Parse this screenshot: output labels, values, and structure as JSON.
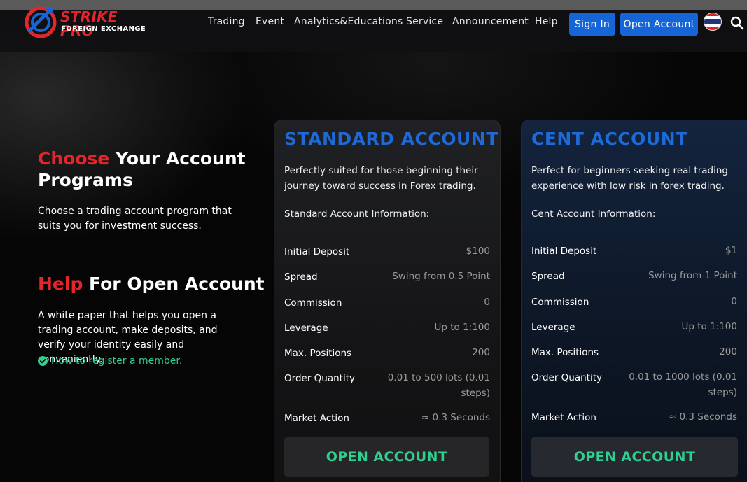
{
  "header": {
    "logo": {
      "name": "STRIKE PRO",
      "tagline": "FOREIGN EXCHANGE"
    },
    "nav": [
      "Trading",
      "Event",
      "Analytics&Educations",
      "Service",
      "Announcement",
      "Help"
    ],
    "sign_in": "Sign In",
    "open_account": "Open Account",
    "flag_icon": "thailand-flag-icon",
    "search_icon": "search-icon"
  },
  "left": {
    "choose_highlight": "Choose",
    "choose_rest": " Your Account",
    "choose_line2": "Programs",
    "choose_desc": "Choose a trading account program that suits you for investment success.",
    "help_highlight": "Help",
    "help_rest": " For Open Account",
    "help_desc": "A white paper that helps you open a trading account, make deposits, and verify your identity easily and conveniently.",
    "register_link": "How to register a member."
  },
  "cards": [
    {
      "title": "STANDARD ACCOUNT",
      "desc": "Perfectly suited for those beginning their journey toward success in Forex trading.",
      "info": "Standard Account Information:",
      "rows": [
        {
          "label": "Initial Deposit",
          "value": "$100"
        },
        {
          "label": "Spread",
          "value": "Swing from 0.5 Point"
        },
        {
          "label": "Commission",
          "value": "0"
        },
        {
          "label": "Leverage",
          "value": "Up to 1:100"
        },
        {
          "label": "Max. Positions",
          "value": "200"
        },
        {
          "label": "Order Quantity",
          "value": "0.01 to 500 lots (0.01 steps)"
        },
        {
          "label": "Market Action",
          "value": "≈ 0.3 Seconds"
        }
      ],
      "button": "OPEN ACCOUNT"
    },
    {
      "title": "CENT ACCOUNT",
      "desc": "Perfect for beginners seeking real trading experience with low risk in forex trading.",
      "info": "Cent Account Information:",
      "rows": [
        {
          "label": "Initial Deposit",
          "value": "$1"
        },
        {
          "label": "Spread",
          "value": "Swing from 1 Point"
        },
        {
          "label": "Commission",
          "value": "0"
        },
        {
          "label": "Leverage",
          "value": "Up to 1:100"
        },
        {
          "label": "Max. Positions",
          "value": "200"
        },
        {
          "label": "Order Quantity",
          "value": "0.01 to 1000 lots (0.01 steps)"
        },
        {
          "label": "Market Action",
          "value": "≈ 0.3 Seconds"
        }
      ],
      "button": "OPEN ACCOUNT"
    }
  ],
  "colors": {
    "brand_red": "#e3262b",
    "accent_blue": "#1565d8",
    "title_blue": "#1d6ad8",
    "link_green": "#2fcf8f"
  }
}
